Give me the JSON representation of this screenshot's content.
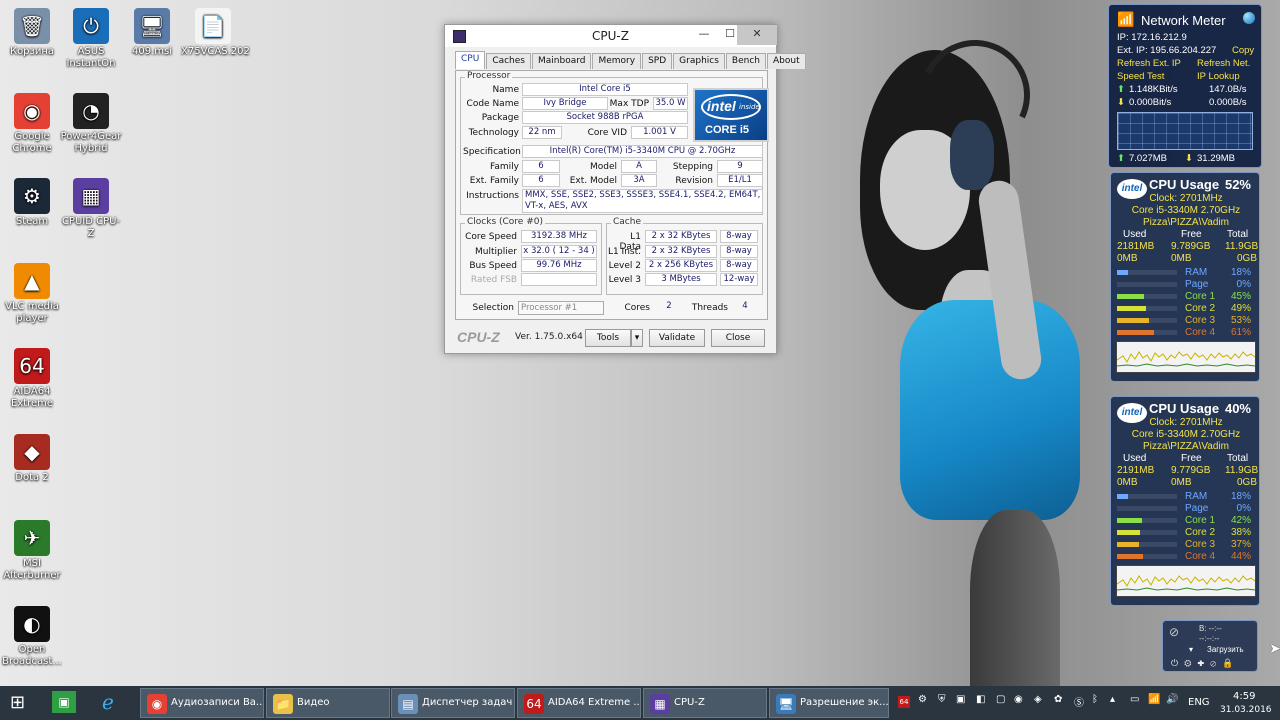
{
  "desktop": {
    "icons": [
      {
        "label": "Корзина",
        "glyph": "🗑",
        "color": "#7a8fa8"
      },
      {
        "label": "ASUS InstantOn",
        "glyph": "⏻",
        "color": "#1a6db8"
      },
      {
        "label": "409.msi",
        "glyph": "🖥",
        "color": "#5a7ba8"
      },
      {
        "label": "X75VCAS.202",
        "glyph": "📄",
        "color": "#f4f4f4"
      },
      {
        "label": "Google Chrome",
        "glyph": "◉",
        "color": "#e44134"
      },
      {
        "label": "Power4Gear Hybrid",
        "glyph": "◔",
        "color": "#222222"
      },
      {
        "label": "Steam",
        "glyph": "⚙",
        "color": "#1b2838"
      },
      {
        "label": "CPUID CPU-Z",
        "glyph": "▦",
        "color": "#5b3fa0"
      },
      {
        "label": "VLC media player",
        "glyph": "▲",
        "color": "#f08a00"
      },
      {
        "label": "AIDA64 Extreme",
        "glyph": "64",
        "color": "#c11a1a"
      },
      {
        "label": "Dota 2",
        "glyph": "◆",
        "color": "#a82b22"
      },
      {
        "label": "MSI Afterburner",
        "glyph": "✈",
        "color": "#2a7a2a"
      },
      {
        "label": "Open Broadcast...",
        "glyph": "◐",
        "color": "#111111"
      }
    ]
  },
  "cpuz": {
    "title": "CPU-Z",
    "tabs": [
      "CPU",
      "Caches",
      "Mainboard",
      "Memory",
      "SPD",
      "Graphics",
      "Bench",
      "About"
    ],
    "processor": {
      "group": "Processor",
      "name_label": "Name",
      "name": "Intel Core i5",
      "codename_label": "Code Name",
      "codename": "Ivy Bridge",
      "maxtdp_label": "Max TDP",
      "maxtdp": "35.0 W",
      "package_label": "Package",
      "package": "Socket 988B rPGA",
      "technology_label": "Technology",
      "technology": "22 nm",
      "corevid_label": "Core VID",
      "corevid": "1.001 V",
      "spec_label": "Specification",
      "spec": "Intel(R) Core(TM) i5-3340M CPU @ 2.70GHz",
      "family_label": "Family",
      "family": "6",
      "model_label": "Model",
      "model": "A",
      "stepping_label": "Stepping",
      "stepping": "9",
      "extfamily_label": "Ext. Family",
      "extfamily": "6",
      "extmodel_label": "Ext. Model",
      "extmodel": "3A",
      "revision_label": "Revision",
      "revision": "E1/L1",
      "instructions_label": "Instructions",
      "instructions": "MMX, SSE, SSE2, SSE3, SSSE3, SSE4.1, SSE4.2, EM64T, VT-x, AES, AVX"
    },
    "intel_logo": {
      "word": "intel",
      "inside": "inside",
      "core": "CORE i5"
    },
    "clocks": {
      "group": "Clocks (Core #0)",
      "corespeed_label": "Core Speed",
      "corespeed": "3192.38 MHz",
      "multiplier_label": "Multiplier",
      "multiplier": "x 32.0 ( 12 - 34 )",
      "busspeed_label": "Bus Speed",
      "busspeed": "99.76 MHz",
      "ratedfsb_label": "Rated FSB",
      "ratedfsb": ""
    },
    "cache": {
      "group": "Cache",
      "l1data_label": "L1 Data",
      "l1data": "2 x 32 KBytes",
      "l1data_way": "8-way",
      "l1inst_label": "L1 Inst.",
      "l1inst": "2 x 32 KBytes",
      "l1inst_way": "8-way",
      "l2_label": "Level 2",
      "l2": "2 x 256 KBytes",
      "l2_way": "8-way",
      "l3_label": "Level 3",
      "l3": "3 MBytes",
      "l3_way": "12-way"
    },
    "selection_label": "Selection",
    "selection": "Processor #1",
    "cores_label": "Cores",
    "cores": "2",
    "threads_label": "Threads",
    "threads": "4",
    "brand": "CPU-Z",
    "version": "Ver. 1.75.0.x64",
    "tools": "Tools",
    "validate": "Validate",
    "close": "Close"
  },
  "network_meter": {
    "title": "Network Meter",
    "ip": "IP: 172.16.212.9",
    "ext_ip": "Ext. IP: 195.66.204.227",
    "copy": "Copy",
    "refresh_ext": "Refresh Ext. IP",
    "refresh_net": "Refresh Net.",
    "speed_test": "Speed Test",
    "ip_lookup": "IP Lookup",
    "up_rate": "1.148KBit/s",
    "up_rate2": "147.0B/s",
    "down_rate": "0.000Bit/s",
    "down_rate2": "0.000B/s",
    "up_total": "7.027MB",
    "down_total": "31.29MB"
  },
  "cpu_gadgets": [
    {
      "title": "CPU Usage",
      "percent": "52%",
      "clock": "Clock: 2701MHz",
      "cpu": "Core i5-3340M 2.70GHz",
      "host": "Pizza\\PIZZA\\Vadim",
      "hdr_used": "Used",
      "hdr_free": "Free",
      "hdr_total": "Total",
      "ram_used": "2181MB",
      "ram_free": "9.789GB",
      "ram_total": "11.9GB",
      "page_used": "0MB",
      "page_free": "0MB",
      "page_total": "0GB",
      "bars": [
        {
          "label": "RAM",
          "value": "18%",
          "level": 0.18,
          "color": "#6fa8ff"
        },
        {
          "label": "Page",
          "value": "0%",
          "level": 0.0,
          "color": "#6fa8ff"
        },
        {
          "label": "Core 1",
          "value": "45%",
          "level": 0.45,
          "color": "#8be04a"
        },
        {
          "label": "Core 2",
          "value": "49%",
          "level": 0.49,
          "color": "#d8e03a"
        },
        {
          "label": "Core 3",
          "value": "53%",
          "level": 0.53,
          "color": "#e8b22a"
        },
        {
          "label": "Core 4",
          "value": "61%",
          "level": 0.61,
          "color": "#e0742a"
        }
      ]
    },
    {
      "title": "CPU Usage",
      "percent": "40%",
      "clock": "Clock: 2701MHz",
      "cpu": "Core i5-3340M 2.70GHz",
      "host": "Pizza\\PIZZA\\Vadim",
      "hdr_used": "Used",
      "hdr_free": "Free",
      "hdr_total": "Total",
      "ram_used": "2191MB",
      "ram_free": "9.779GB",
      "ram_total": "11.9GB",
      "page_used": "0MB",
      "page_free": "0MB",
      "page_total": "0GB",
      "bars": [
        {
          "label": "RAM",
          "value": "18%",
          "level": 0.18,
          "color": "#6fa8ff"
        },
        {
          "label": "Page",
          "value": "0%",
          "level": 0.0,
          "color": "#6fa8ff"
        },
        {
          "label": "Core 1",
          "value": "42%",
          "level": 0.42,
          "color": "#8be04a"
        },
        {
          "label": "Core 2",
          "value": "38%",
          "level": 0.38,
          "color": "#d8e03a"
        },
        {
          "label": "Core 3",
          "value": "37%",
          "level": 0.37,
          "color": "#e8b22a"
        },
        {
          "label": "Core 4",
          "value": "44%",
          "level": 0.44,
          "color": "#e0742a"
        }
      ]
    }
  ],
  "download_gadget": {
    "line1": "B: --:--",
    "line2": "--:--:--",
    "label": "Загрузить"
  },
  "taskbar": {
    "items": [
      {
        "label": "Аудиозаписи Ва...",
        "glyph": "◉",
        "color": "#e44134"
      },
      {
        "label": "Видео",
        "glyph": "📁",
        "color": "#e8c04a"
      },
      {
        "label": "Диспетчер задач",
        "glyph": "▤",
        "color": "#6a8fb8"
      },
      {
        "label": "AIDA64 Extreme ...",
        "glyph": "64",
        "color": "#c11a1a"
      },
      {
        "label": "CPU-Z",
        "glyph": "▦",
        "color": "#5b3fa0"
      },
      {
        "label": "Разрешение эк...",
        "glyph": "🖥",
        "color": "#3a7ab8"
      }
    ],
    "lang": "ENG",
    "time": "4:59",
    "date": "31.03.2016"
  }
}
